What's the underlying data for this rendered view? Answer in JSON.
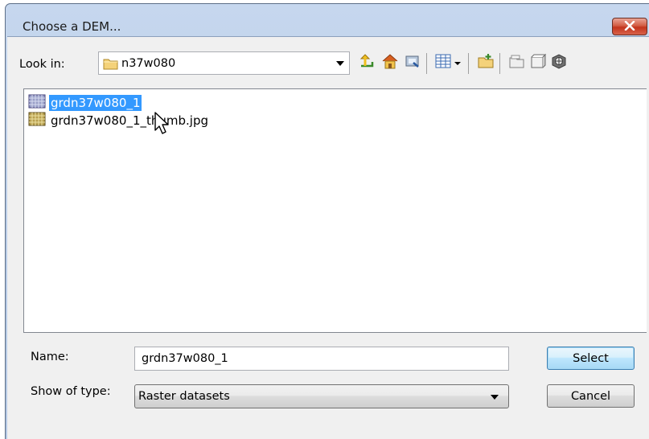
{
  "window": {
    "title": "Choose a DEM..."
  },
  "toolbar": {
    "look_in_label": "Look in:",
    "look_in_value": "n37w080",
    "icons": [
      "up-one-level-icon",
      "home-icon",
      "connect-folder-icon",
      "view-details-icon",
      "view-menu-arrow-icon",
      "new-folder-icon",
      "catalog-icon",
      "gallery-icon",
      "globe-icon"
    ]
  },
  "files": [
    {
      "name": "grdn37w080_1",
      "selected": true
    },
    {
      "name": "grdn37w080_1_thumb.jpg",
      "selected": false
    }
  ],
  "form": {
    "name_label": "Name:",
    "name_value": "grdn37w080_1",
    "type_label": "Show of type:",
    "type_value": "Raster datasets"
  },
  "buttons": {
    "select": "Select",
    "cancel": "Cancel"
  },
  "colors": {
    "selection": "#3399ff",
    "close_button": "#c7402a",
    "frame": "#b9cce6"
  }
}
